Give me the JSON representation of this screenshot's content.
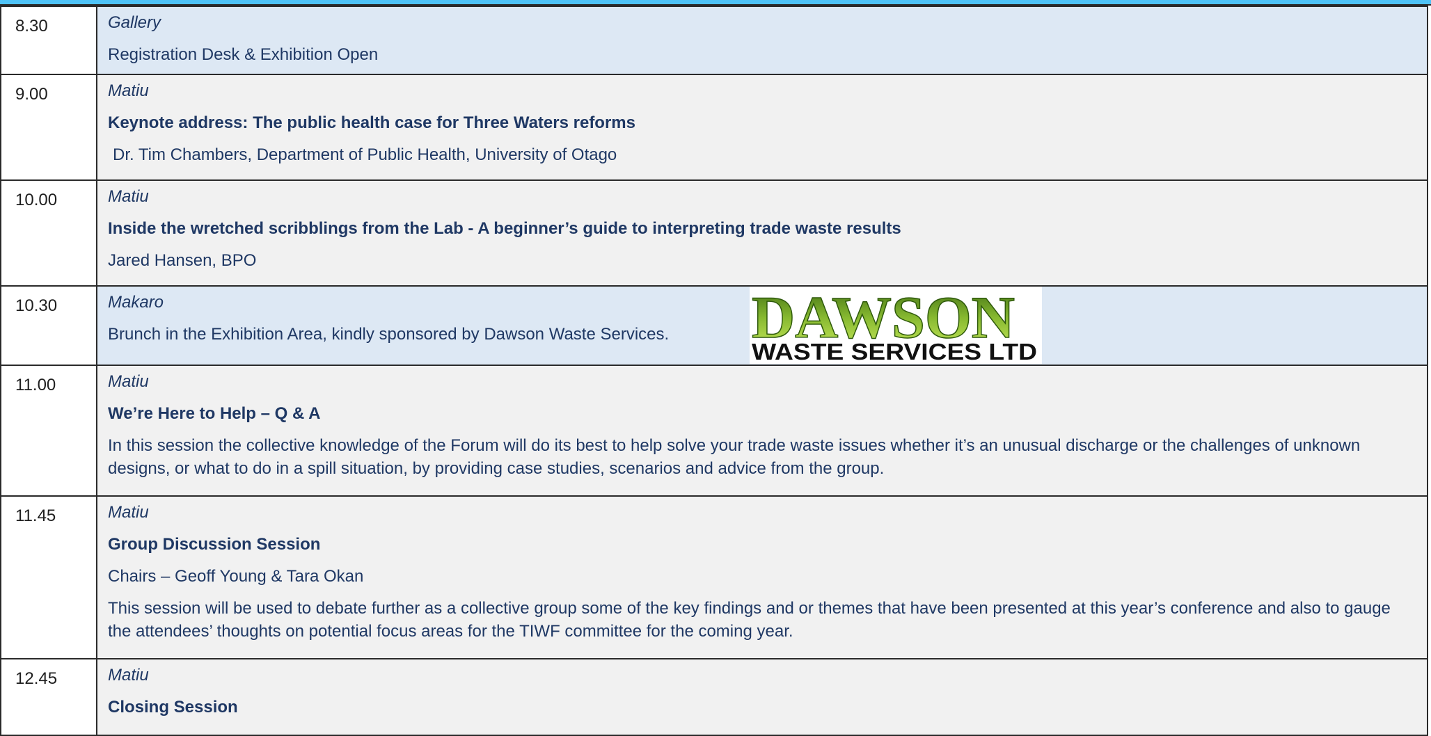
{
  "rows": [
    {
      "time": "8.30",
      "venue": "Gallery",
      "text": "Registration Desk & Exhibition Open"
    },
    {
      "time": "9.00",
      "venue": "Matiu",
      "title": "Keynote address: The public health case for Three Waters reforms",
      "speaker": "Dr. Tim Chambers, Department of Public Health, University of Otago"
    },
    {
      "time": "10.00",
      "venue": "Matiu",
      "title": "Inside the wretched scribblings from the Lab - A beginner’s guide to interpreting trade waste results",
      "speaker": "Jared Hansen, BPO"
    },
    {
      "time": "10.30",
      "venue": "Makaro",
      "text": "Brunch in the Exhibition Area, kindly sponsored by Dawson Waste Services.",
      "logo": {
        "word": "DAWSON",
        "subtitle": "WASTE SERVICES LTD",
        "color_top": "#3c6b12",
        "color_bottom": "#b8e04a"
      }
    },
    {
      "time": "11.00",
      "venue": "Matiu",
      "title": "We’re Here to Help – Q & A",
      "description": "In this session the collective knowledge of the Forum will do its best to help solve your trade waste issues whether it’s an unusual discharge or the challenges of unknown designs, or what to do in a spill situation, by providing case studies, scenarios and advice from the group."
    },
    {
      "time": "11.45",
      "venue": "Matiu",
      "title": "Group Discussion Session",
      "speaker": "Chairs – Geoff Young & Tara Okan",
      "description": "This session will be used to debate further as a collective group some of the key findings and or themes that have been presented at this year’s conference and also to gauge the attendees’ thoughts on potential focus areas for the TIWF committee for the coming year."
    },
    {
      "time": "12.45",
      "venue": "Matiu",
      "title": "Closing Session"
    }
  ],
  "colors": {
    "blue_row": "#dde8f4",
    "grey_row": "#f1f1f1",
    "text": "#1f3864",
    "top_bar": "#4fc3f7"
  }
}
